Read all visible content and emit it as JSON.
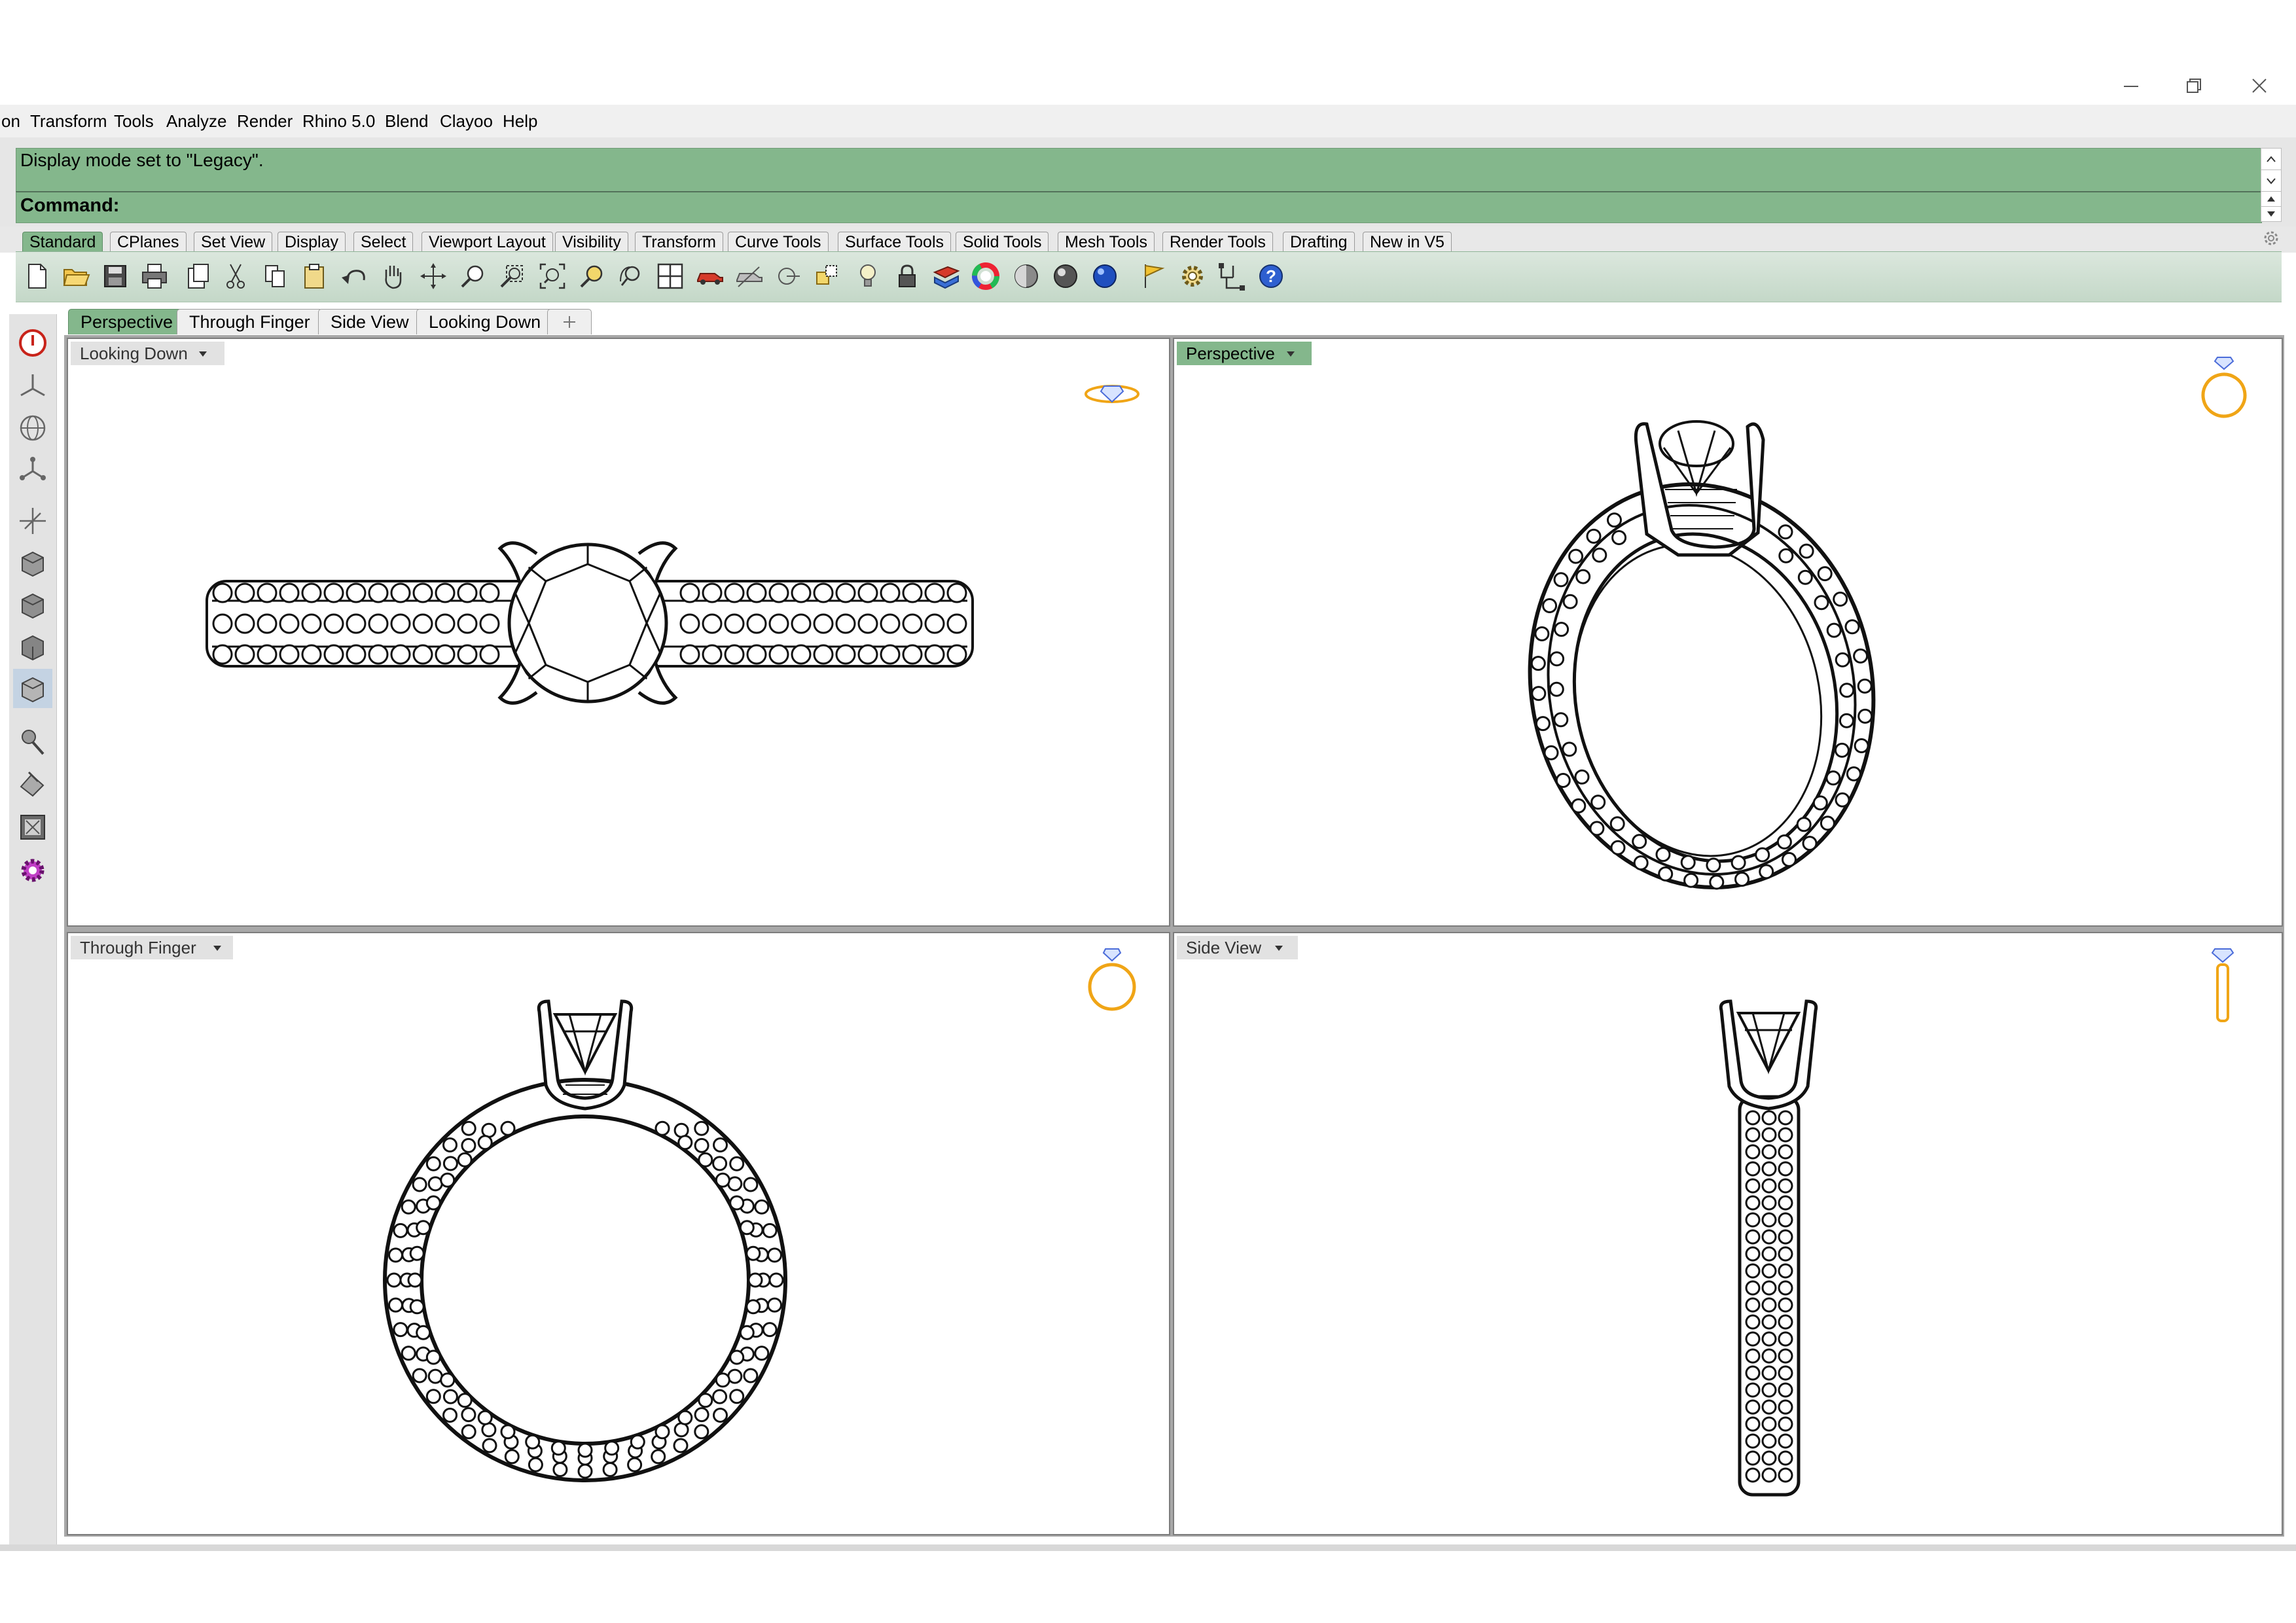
{
  "window": {
    "minimize_icon": "minimize-icon",
    "restore_icon": "restore-icon",
    "close_icon": "close-icon"
  },
  "menu": {
    "items": [
      {
        "label": "on"
      },
      {
        "label": "Transform"
      },
      {
        "label": "Tools"
      },
      {
        "label": "Analyze"
      },
      {
        "label": "Render"
      },
      {
        "label": "Rhino 5.0"
      },
      {
        "label": "Blend"
      },
      {
        "label": "Clayoo"
      },
      {
        "label": "Help"
      }
    ]
  },
  "command": {
    "history_text": "Display mode set to \"Legacy\".",
    "prompt_label": "Command:",
    "accent_color": "#84b78c"
  },
  "toolbar_tabs": [
    {
      "label": "Standard"
    },
    {
      "label": "CPlanes"
    },
    {
      "label": "Set View"
    },
    {
      "label": "Display"
    },
    {
      "label": "Select"
    },
    {
      "label": "Viewport Layout"
    },
    {
      "label": "Visibility"
    },
    {
      "label": "Transform"
    },
    {
      "label": "Curve Tools"
    },
    {
      "label": "Surface Tools"
    },
    {
      "label": "Solid Tools"
    },
    {
      "label": "Mesh Tools"
    },
    {
      "label": "Render Tools"
    },
    {
      "label": "Drafting"
    },
    {
      "label": "New in V5"
    }
  ],
  "toolbar_settings_icon": "gear-icon",
  "tools": [
    "new-file-icon",
    "open-folder-icon",
    "save-icon",
    "print-icon",
    "import-icon",
    "cut-icon",
    "copy-icon",
    "paste-icon",
    "undo-icon",
    "pan-hand-icon",
    "rotate-view-icon",
    "zoom-dynamic-icon",
    "zoom-window-icon",
    "zoom-extents-icon",
    "zoom-selected-icon",
    "undo-view-icon",
    "four-viewports-icon",
    "car-icon",
    "hidden-car-icon",
    "osnap-icon",
    "select-filter-icon",
    "light-bulb-icon",
    "lock-icon",
    "layer-icon",
    "color-wheel-icon",
    "shaded-sphere-icon",
    "rendered-sphere-icon",
    "blue-sphere-icon",
    "flag-icon",
    "options-gear-icon",
    "grouping-icon",
    "help-icon"
  ],
  "left_tools": [
    "record-history-icon",
    "axes-icon",
    "globe-icon",
    "network-icon",
    "gumball-icon",
    "box-icon-1",
    "box-icon-2",
    "box-icon-3",
    "box-icon-4",
    "render-brush-icon",
    "paint-icon",
    "frame-icon",
    "plugin-gear-icon"
  ],
  "viewport_tabs": [
    {
      "label": "Perspective",
      "active": true
    },
    {
      "label": "Through Finger"
    },
    {
      "label": "Side View"
    },
    {
      "label": "Looking Down"
    }
  ],
  "viewport_add_icon": "add-tab-icon",
  "viewports": {
    "top_left": {
      "label": "Looking Down"
    },
    "top_right": {
      "label": "Perspective"
    },
    "bottom_left": {
      "label": "Through Finger"
    },
    "bottom_right": {
      "label": "Side View"
    }
  }
}
